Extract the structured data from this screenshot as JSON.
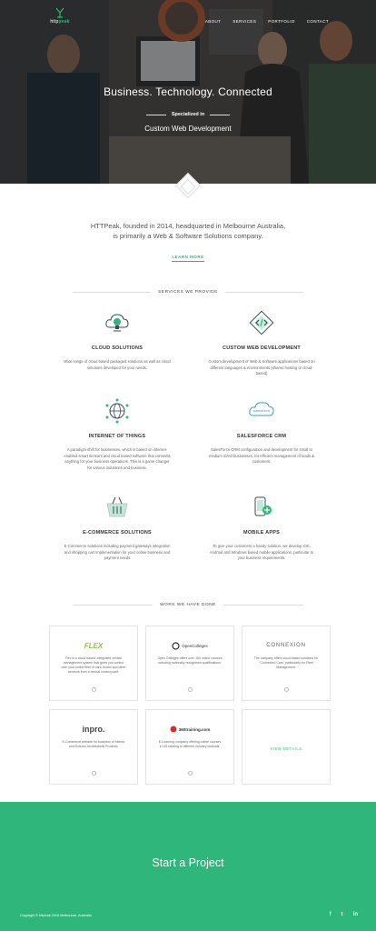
{
  "brand": {
    "logo_prefix": "http",
    "logo_suffix": "peak"
  },
  "nav": {
    "items": [
      "ABOUT",
      "SERVICES",
      "PORTFOLIO",
      "CONTACT"
    ]
  },
  "hero": {
    "title": "Business. Technology. Connected",
    "tag": "Specialized in",
    "subtitle": "Custom Web Development"
  },
  "intro": {
    "line1": "HTTPeak, founded in 2014, headquarted in Melbourne Australia,",
    "line2": "is primarily a Web & Software Solutions company.",
    "learn_more": "LEARN MORE"
  },
  "services": {
    "heading": "SERVICES WE PROVIDE",
    "items": [
      {
        "title": "CLOUD SOLUTIONS",
        "icon": "cloud-bulb-icon",
        "desc": "Wide range of cloud based packaged solutions as well as cloud solutions developed for your needs."
      },
      {
        "title": "CUSTOM WEB DEVELOPMENT",
        "icon": "code-diamond-icon",
        "desc": "Custom development of Web & Software applications based on different languages & environments (shared hosting or cloud-based)"
      },
      {
        "title": "INTERNET OF THINGS",
        "icon": "globe-network-icon",
        "desc": "A paradigm shift for businesses, which is based on internet-enabled smart sensors and cloud based software that connects anything for your business operations. This is a game changer for various industries and business."
      },
      {
        "title": "SALESFORCE CRM",
        "icon": "salesforce-cloud-icon",
        "desc": "SalesForce CRM configuration and development for small to medium sized businesses, for efficient management of leads & customers."
      },
      {
        "title": "E-COMMERCE SOLUTIONS",
        "icon": "shopping-basket-icon",
        "desc": "E-Commerce solutions including payment gateways integration and shopping cart implementation for your online business and payment needs"
      },
      {
        "title": "MOBILE APPS",
        "icon": "mobile-app-icon",
        "desc": "To give your customers a handy solution, we develop iOS, Android and Windows based mobile applications, particular to your business requirements."
      }
    ],
    "salesforce_word": "salesforce"
  },
  "work": {
    "heading": "WORK WE HAVE DONE",
    "items": [
      {
        "brand": "FLEX",
        "desc": "Flex is a cloud based, integrated vehicle management system that gives you control over your online fleet of cars, trucks and other services from a central control point."
      },
      {
        "brand": "OpenColleges",
        "desc": "Open Colleges offers over 150 online courses including nationally recognised qualifications."
      },
      {
        "brand": "CONNEXION",
        "desc": "The company offers cloud based solutions for \"Connected Cars\" particularly for Fleet Management."
      },
      {
        "brand": "inpro.",
        "desc": "E-Commerce website for business of Interior and Exterior Architectural Products"
      },
      {
        "brand": "360training.com",
        "desc": "E-Learning company offering online courses in US relating to different industry verticals."
      }
    ],
    "view_details": "VIEW DETAILS"
  },
  "cta": {
    "title": "Start a Project",
    "copyright": "Copyright © httpeak 2016 Melbourne, Australia",
    "social": [
      "f",
      "t",
      "in"
    ]
  },
  "colors": {
    "accent": "#2fb67a",
    "hero_overlay": "#2a2a2a"
  }
}
